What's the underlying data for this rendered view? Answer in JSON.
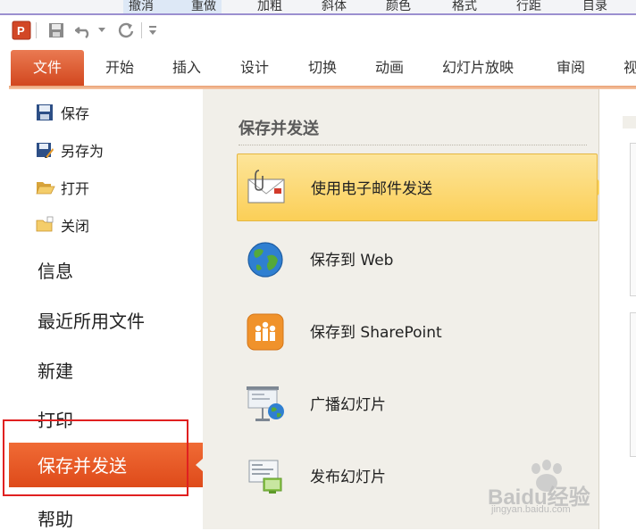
{
  "background_toolbar": {
    "tabs": [
      "撤消",
      "重做",
      "加粗",
      "斜体",
      "颜色",
      "格式",
      "行距",
      "目录"
    ]
  },
  "ribbon": {
    "file_tab": "文件",
    "tabs": [
      "开始",
      "插入",
      "设计",
      "切换",
      "动画",
      "幻灯片放映",
      "审阅",
      "视"
    ]
  },
  "nav": {
    "small_items": [
      {
        "label": "保存",
        "icon": "floppy-disk-icon"
      },
      {
        "label": "另存为",
        "icon": "save-as-icon"
      },
      {
        "label": "打开",
        "icon": "open-folder-icon"
      },
      {
        "label": "关闭",
        "icon": "close-folder-icon"
      }
    ],
    "big_items": [
      "信息",
      "最近所用文件",
      "新建",
      "打印"
    ],
    "active_item": "保存并发送",
    "help_item": "帮助"
  },
  "save_send": {
    "title": "保存并发送",
    "options": [
      {
        "label": "使用电子邮件发送",
        "icon": "email-attachment-icon",
        "selected": true
      },
      {
        "label": "保存到 Web",
        "icon": "globe-icon",
        "selected": false
      },
      {
        "label": "保存到 SharePoint",
        "icon": "sharepoint-icon",
        "selected": false
      },
      {
        "label": "广播幻灯片",
        "icon": "broadcast-slideshow-icon",
        "selected": false
      },
      {
        "label": "发布幻灯片",
        "icon": "publish-slides-icon",
        "selected": false
      }
    ]
  },
  "colors": {
    "file_tab": "#d2471e",
    "active_nav": "#f06b35",
    "selected_option": "#fbcf57",
    "highlight_box": "#e02020"
  },
  "watermark": {
    "brand": "Baidu经验",
    "url": "jingyan.baidu.com"
  }
}
